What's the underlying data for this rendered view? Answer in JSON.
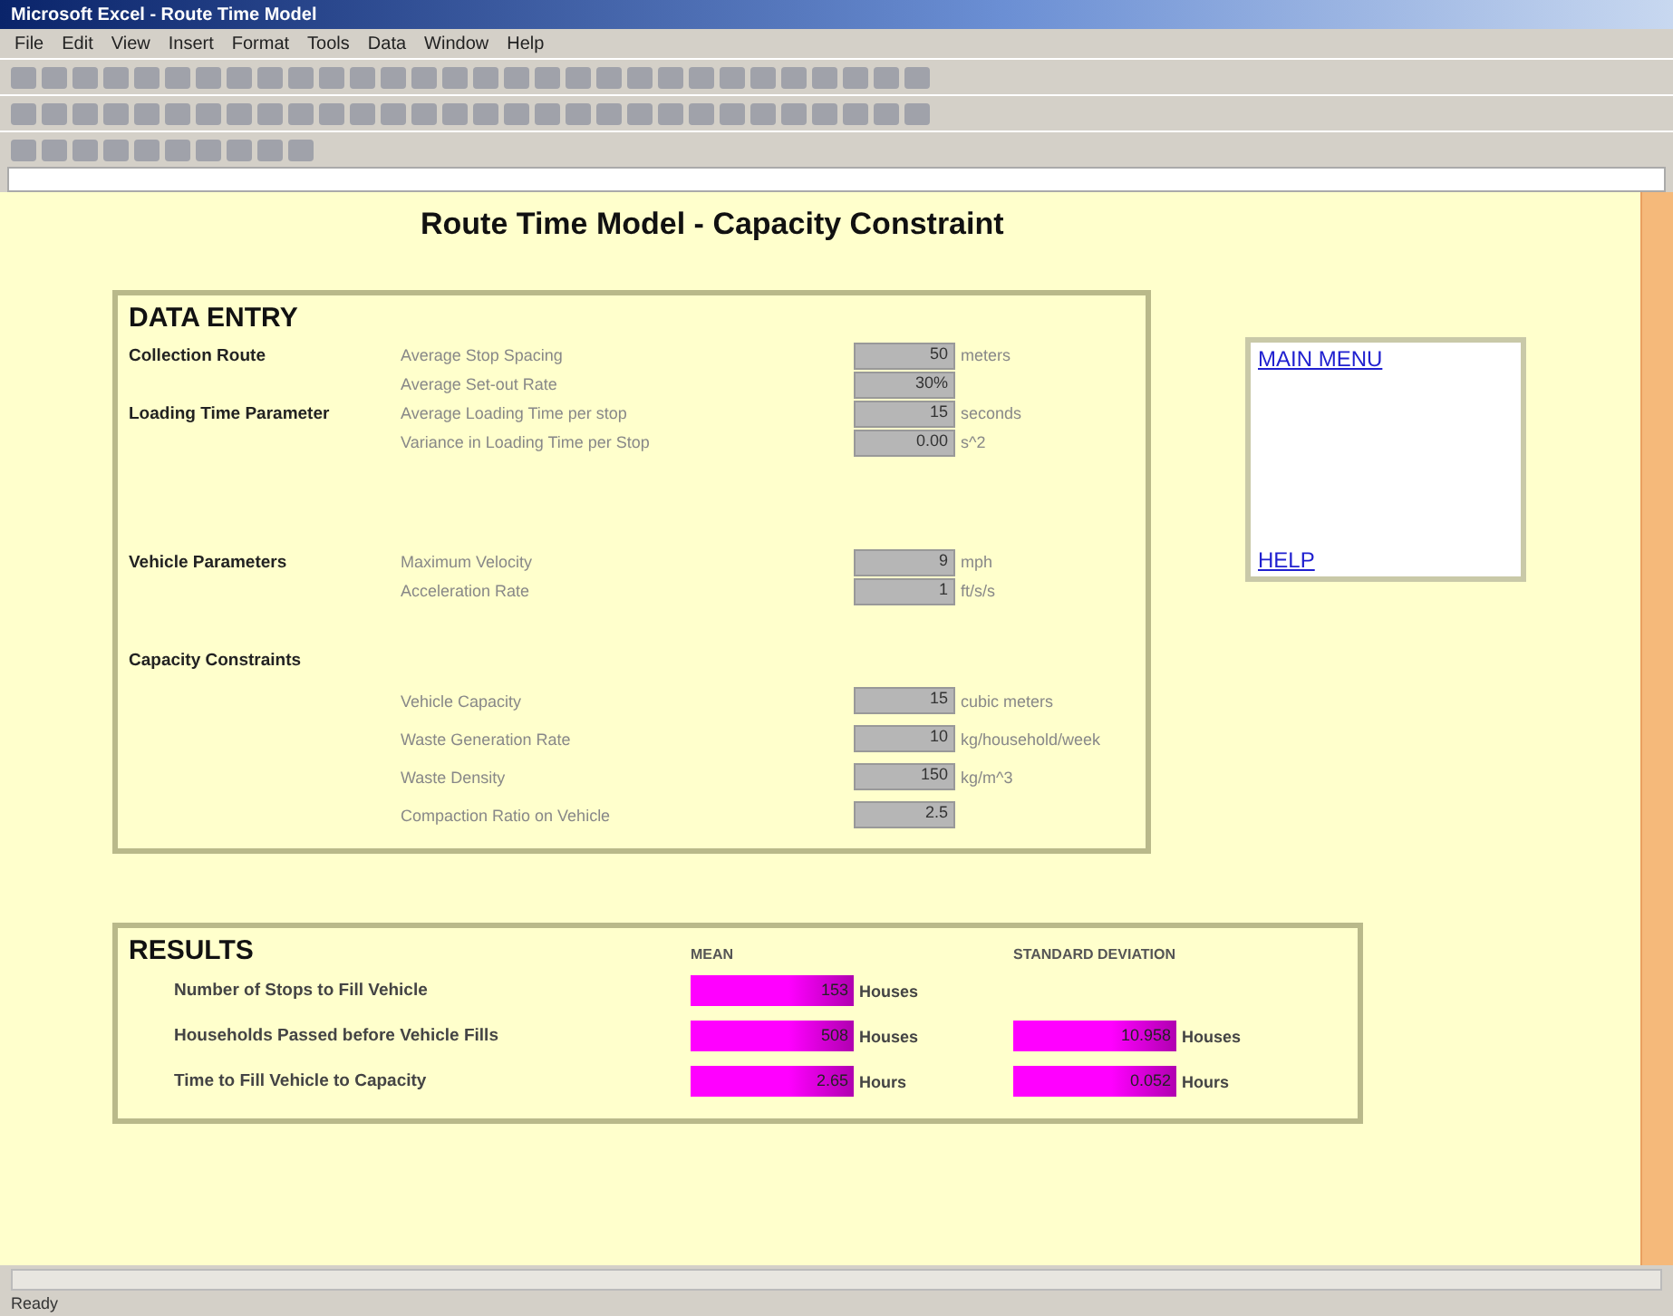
{
  "window": {
    "title": "Microsoft Excel - Route Time Model"
  },
  "menu": [
    "File",
    "Edit",
    "View",
    "Insert",
    "Format",
    "Tools",
    "Data",
    "Window",
    "Help"
  ],
  "sheet_title": "Route Time Model - Capacity Constraint",
  "data_entry": {
    "title": "DATA ENTRY",
    "groups": [
      {
        "category": "Collection Route",
        "kind": "inline",
        "rows": [
          {
            "label": "Average Stop Spacing",
            "value": "50",
            "unit": "meters"
          },
          {
            "label": "Average Set-out Rate",
            "value": "30%",
            "unit": ""
          }
        ]
      },
      {
        "category": "Loading Time Parameter",
        "kind": "inline",
        "rows": [
          {
            "label": "Average Loading Time per stop",
            "value": "15",
            "unit": "seconds"
          },
          {
            "label": "Variance in Loading Time per Stop",
            "value": "0.00",
            "unit": "s^2"
          }
        ]
      },
      {
        "category": "Vehicle Parameters",
        "kind": "inline",
        "rows": [
          {
            "label": "Maximum Velocity",
            "value": "9",
            "unit": "mph"
          },
          {
            "label": "Acceleration Rate",
            "value": "1",
            "unit": "ft/s/s"
          }
        ]
      },
      {
        "category": "Capacity Constraints",
        "kind": "above",
        "rows": [
          {
            "label": "Vehicle Capacity",
            "value": "15",
            "unit": "cubic meters"
          },
          {
            "label": "Waste Generation Rate",
            "value": "10",
            "unit": "kg/household/week"
          },
          {
            "label": "Waste Density",
            "value": "150",
            "unit": "kg/m^3"
          },
          {
            "label": "Compaction Ratio on Vehicle",
            "value": "2.5",
            "unit": ""
          }
        ]
      }
    ]
  },
  "links": [
    {
      "label": "MAIN MENU"
    },
    {
      "label": "HELP"
    }
  ],
  "results": {
    "title": "RESULTS",
    "columns": [
      "MEAN",
      "STANDARD DEVIATION"
    ],
    "rows": [
      {
        "label": "Number of Stops to Fill Vehicle",
        "mean": "153",
        "mean_unit": "Houses"
      },
      {
        "label": "Households Passed before Vehicle Fills",
        "mean": "508",
        "mean_unit": "Houses",
        "sd": "10.958",
        "sd_unit": "Houses"
      },
      {
        "label": "Time to Fill Vehicle to Capacity",
        "mean": "2.65",
        "mean_unit": "Hours",
        "sd": "0.052",
        "sd_unit": "Hours"
      }
    ]
  },
  "status_bar": {
    "text": "Ready"
  }
}
